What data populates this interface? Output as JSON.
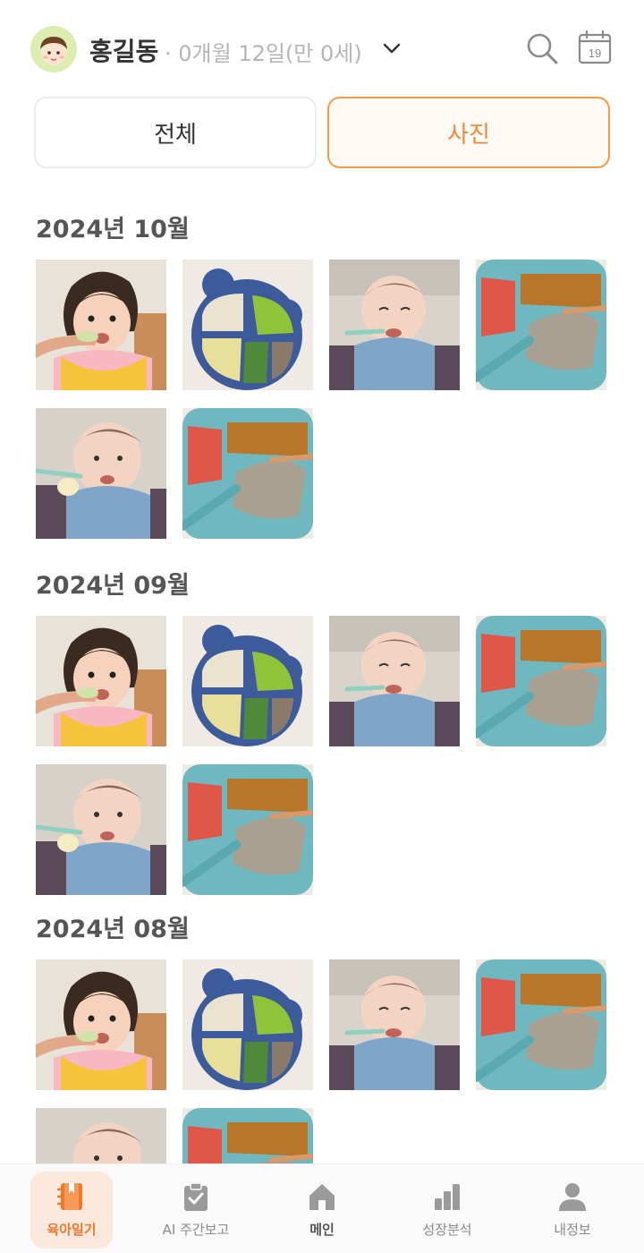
{
  "header": {
    "child_name": "홍길동",
    "child_age": "· 0개월 12일(만 0세)",
    "calendar_day": "19",
    "avatar_icon": "baby-face-icon",
    "chevron_icon": "chevron-down-icon",
    "search_icon": "search-icon",
    "calendar_icon": "calendar-icon"
  },
  "tabs": [
    {
      "label": "전체",
      "selected": false
    },
    {
      "label": "사진",
      "selected": true
    }
  ],
  "sections": [
    {
      "title": "2024년 10월",
      "photos": [
        "baby-girl-eating",
        "blue-bear-plate",
        "baby-blue-bib",
        "teal-plate-meal",
        "baby-blue-bib-spoon",
        "teal-plate-meal"
      ]
    },
    {
      "title": "2024년 09월",
      "photos": [
        "baby-girl-eating",
        "blue-bear-plate",
        "baby-blue-bib",
        "teal-plate-meal",
        "baby-blue-bib-spoon",
        "teal-plate-meal"
      ]
    },
    {
      "title": "2024년 08월",
      "photos": [
        "baby-girl-eating",
        "blue-bear-plate",
        "baby-blue-bib",
        "teal-plate-meal",
        "baby-blue-bib-spoon",
        "teal-plate-meal"
      ]
    }
  ],
  "bottom_nav": [
    {
      "label": "육아일기",
      "icon": "diary-icon",
      "active": true
    },
    {
      "label": "AI 주간보고",
      "icon": "clipboard-check-icon",
      "active": false
    },
    {
      "label": "메인",
      "icon": "home-icon",
      "active": false
    },
    {
      "label": "성장분석",
      "icon": "bar-chart-icon",
      "active": false
    },
    {
      "label": "내정보",
      "icon": "person-icon",
      "active": false
    }
  ],
  "colors": {
    "accent": "#f08a3a",
    "accent_border": "#f39a4a",
    "nav_active_bg": "#fde8dd",
    "title_text": "#555555",
    "muted_text": "#b5b5b5"
  }
}
